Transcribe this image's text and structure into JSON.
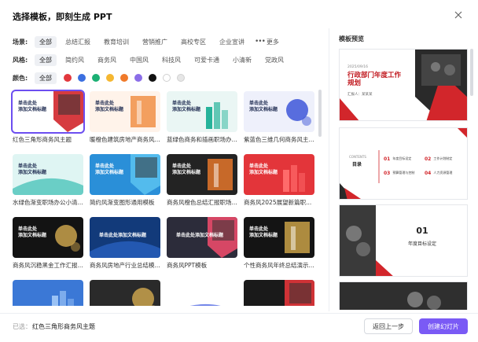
{
  "dialog": {
    "title": "选择模板，即刻生成 PPT",
    "close_icon": "close-icon"
  },
  "filters": {
    "scene": {
      "label": "场景:",
      "options": [
        "全部",
        "总结汇报",
        "教育培训",
        "营销推广",
        "高校专区",
        "企业宣讲"
      ],
      "active": 0,
      "more_label": "更多"
    },
    "style": {
      "label": "风格:",
      "options": [
        "全部",
        "简约风",
        "商务风",
        "中国风",
        "科技风",
        "可爱卡通",
        "小清新",
        "党政风"
      ],
      "active": 0
    },
    "color": {
      "label": "颜色:",
      "all_label": "全部",
      "swatches": [
        "#e2383d",
        "#3b6fe0",
        "#1bb074",
        "#f5b731",
        "#f07a2a",
        "#8b6ee8",
        "#111111",
        "#ffffff",
        "#e6e6e6"
      ]
    }
  },
  "templates": [
    {
      "name": "红色三角形商务风主题",
      "thumb_text": "单击此处\n添加文档标题",
      "bg": "#ffffff",
      "accent": "#d2262b",
      "selected": true
    },
    {
      "name": "暖橙色建筑房地产商务风...",
      "thumb_text": "单击此处\n添加文档标题",
      "bg": "#fff3ea",
      "accent": "#f08a3c"
    },
    {
      "name": "蓝绿色商务和插画职场办...",
      "thumb_text": "单击此处\n添加文档标题",
      "bg": "#eaf6f4",
      "accent": "#26b39a"
    },
    {
      "name": "紫蓝色三维几何商务风主...",
      "thumb_text": "单击此处\n添加文档标题",
      "bg": "#eef0fb",
      "accent": "#3d56d8"
    },
    {
      "name": "水绿色渐变职场办公小清...",
      "thumb_text": "单击此处\n添加文档标题",
      "bg": "#dff5f3",
      "accent": "#37bdb2"
    },
    {
      "name": "简约风渐变图形通用模板",
      "thumb_text": "单击此处\n添加文档标题",
      "bg": "#2a8fd8",
      "accent": "#58c0f0"
    },
    {
      "name": "商务风橙色总结汇报职场...",
      "thumb_text": "单击此处\n添加文档标题",
      "bg": "#232323",
      "accent": "#f07a2a"
    },
    {
      "name": "商务风2025展望新篇职...",
      "thumb_text": "单击此处\n添加文档标题",
      "bg": "#e3353a",
      "accent": "#ff6b6b"
    },
    {
      "name": "商务风沉稳黑金工作汇报...",
      "thumb_text": "单击此处\n添加文档标题",
      "bg": "#131313",
      "accent": "#c9a24c"
    },
    {
      "name": "商务风房地产行业总结模...",
      "thumb_text": "单击此处添加文档标题",
      "bg": "#123a7a",
      "accent": "#2b65c9"
    },
    {
      "name": "商务风PPT模板",
      "thumb_text": "单击此处添加文档标题",
      "bg": "#2c2c3a",
      "accent": "#e94a6a"
    },
    {
      "name": "个性商务风年终总结演示...",
      "thumb_text": "单击此处\n添加文档标题",
      "bg": "#141414",
      "accent": "#d3a94a"
    },
    {
      "name": "",
      "thumb_text": "",
      "bg": "#3b78d6",
      "accent": "#9ac2f5"
    },
    {
      "name": "",
      "thumb_text": "",
      "bg": "#2a2a2a",
      "accent": "#c9a24c"
    },
    {
      "name": "",
      "thumb_text": "",
      "bg": "#ffffff",
      "accent": "#3b55e0"
    },
    {
      "name": "",
      "thumb_text": "",
      "bg": "#1a1a1a",
      "accent": "#e3353a"
    }
  ],
  "preview": {
    "title": "模板预览",
    "slides": [
      {
        "date": "2025/09/16",
        "heading": "行政部门年度工作\n规划",
        "sub": "汇报人：某某某"
      },
      {
        "contents_en": "CONTENTS",
        "contents_cn": "目录",
        "items": [
          {
            "num": "01",
            "text": "年度目标设定"
          },
          {
            "num": "02",
            "text": "工作计划制定"
          },
          {
            "num": "03",
            "text": "预算管理与控制"
          },
          {
            "num": "04",
            "text": "人力资源管理"
          }
        ]
      },
      {
        "num": "01",
        "text": "年度目标设定"
      },
      {}
    ]
  },
  "footer": {
    "selected_label": "已选：",
    "selected_value": "红色三角形商务风主题",
    "back_label": "返回上一步",
    "create_label": "创建幻灯片",
    "accent": "#7a5af5"
  }
}
